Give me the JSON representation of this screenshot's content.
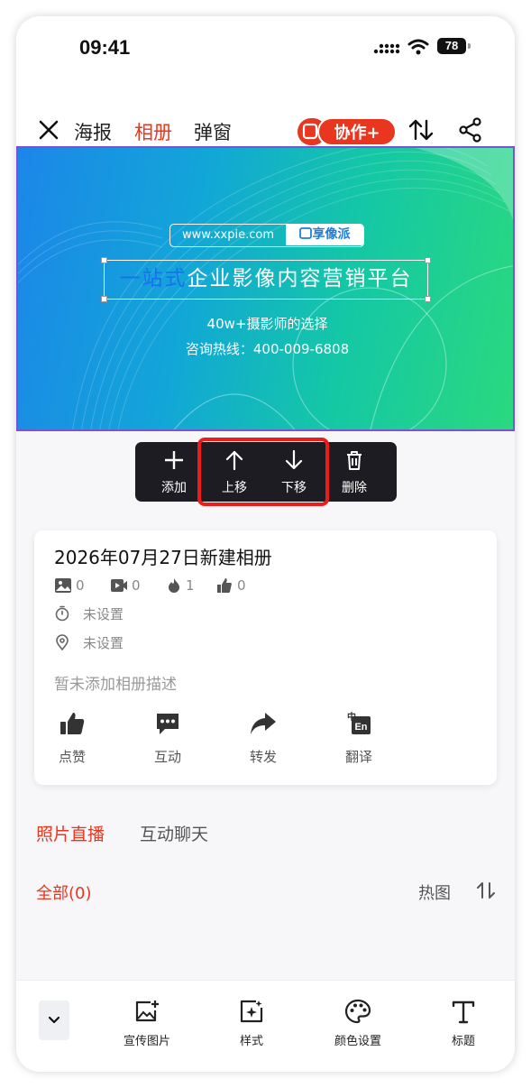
{
  "status_bar": {
    "time": "09:41",
    "battery": "78"
  },
  "nav": {
    "tabs": [
      {
        "label": "海报",
        "active": false
      },
      {
        "label": "相册",
        "active": true
      },
      {
        "label": "弹窗",
        "active": false
      }
    ],
    "collab_label": "协作+"
  },
  "banner": {
    "url": "www.xxpie.com",
    "brand": "享像派",
    "headline_highlight": "一站式",
    "headline_rest": "企业影像内容营销平台",
    "line1": "40w+摄影师的选择",
    "line2": "咨询热线：400-009-6808"
  },
  "toolbar": {
    "add": "添加",
    "move_up": "上移",
    "move_down": "下移",
    "delete": "删除"
  },
  "album": {
    "title": "2026年07月27日新建相册",
    "stats": {
      "photos": "0",
      "videos": "0",
      "heat": "1",
      "likes": "0"
    },
    "time": "未设置",
    "location": "未设置",
    "description": "暂未添加相册描述",
    "actions": {
      "like": "点赞",
      "interact": "互动",
      "forward": "转发",
      "translate": "翻译"
    }
  },
  "subtabs": [
    {
      "label": "照片直播",
      "active": true
    },
    {
      "label": "互动聊天",
      "active": false
    }
  ],
  "filter": {
    "all": "全部(0)",
    "hot": "热图"
  },
  "bottom_bar": {
    "promo_image": "宣传图片",
    "style": "样式",
    "color": "颜色设置",
    "title": "标题"
  },
  "colors": {
    "accent": "#e8361f",
    "highlight_border": "#ee1b1b",
    "toolbar_bg": "#1c1c22"
  }
}
